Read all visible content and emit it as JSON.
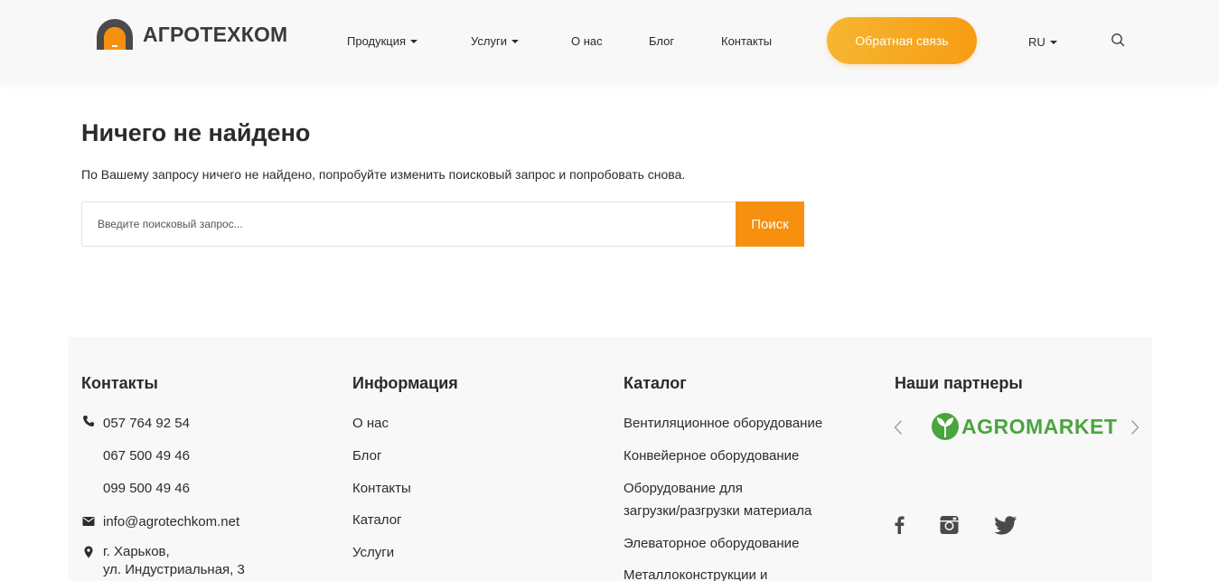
{
  "header": {
    "logo_text": "АГРОТЕХКОМ",
    "nav": [
      {
        "label": "Продукция"
      },
      {
        "label": "Услуги"
      },
      {
        "label": "О нас"
      },
      {
        "label": "Блог"
      },
      {
        "label": "Контакты"
      }
    ],
    "cta_label": "Обратная связь",
    "language": "RU"
  },
  "main": {
    "title": "Ничего не найдено",
    "text": "По Вашему запросу ничего не найдено, попробуйте изменить поисковый запрос и попробовать снова.",
    "search_placeholder": "Введите поисковый запрос...",
    "search_button": "Поиск"
  },
  "footer": {
    "contacts": {
      "title": "Контакты",
      "phones": [
        "057 764 92 54",
        "067 500 49 46",
        "099 500 49 46"
      ],
      "email": "info@agrotechkom.net",
      "address_line1": "г. Харьков,",
      "address_line2": "ул. Индустриальная, 3"
    },
    "info": {
      "title": "Информация",
      "links": [
        "О нас",
        "Блог",
        "Контакты",
        "Каталог",
        "Услуги"
      ]
    },
    "catalog": {
      "title": "Каталог",
      "links": [
        "Вентиляционное оборудование",
        "Конвейерное оборудование",
        "Оборудование для",
        "загрузки/разгрузки материала",
        "Элеваторное оборудование",
        "Металлоконструкции и"
      ]
    },
    "partners": {
      "title": "Наши партнеры",
      "partner_name": "AGROMARKET"
    },
    "social": [
      "facebook-icon",
      "instagram-icon",
      "twitter-icon"
    ]
  },
  "colors": {
    "accent": "#f7900f",
    "cta_gradient_start": "#f6b630",
    "partner_green": "#4aa53f"
  }
}
